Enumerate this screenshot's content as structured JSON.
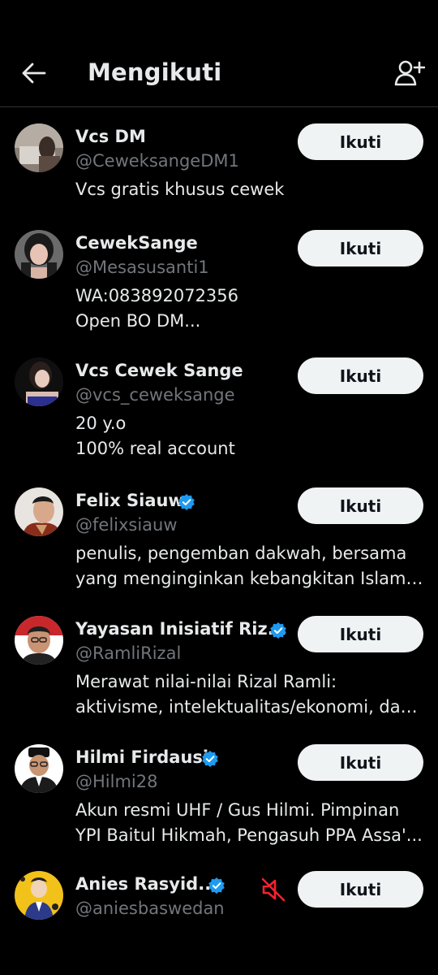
{
  "header": {
    "title": "Mengikuti"
  },
  "colors": {
    "background": "#000000",
    "text": "#e7e9ea",
    "secondary": "#71767b",
    "verified": "#1d9bf0",
    "button_bg": "#eff3f4",
    "muted": "#f4212e"
  },
  "users": [
    {
      "name": "Vcs DM",
      "handle": "@CeweksangeDM1",
      "bio": [
        "Vcs gratis khusus cewek"
      ],
      "verified": false,
      "follow_label": "Ikuti"
    },
    {
      "name": "CewekSange",
      "handle": "@Mesasusanti1",
      "bio": [
        "WA:083892072356",
        "Open BO DM..."
      ],
      "verified": false,
      "follow_label": "Ikuti"
    },
    {
      "name": "Vcs Cewek Sange",
      "handle": "@vcs_ceweksange",
      "bio": [
        "20 y.o",
        "100% real account"
      ],
      "verified": false,
      "follow_label": "Ikuti"
    },
    {
      "name": "Felix Siauw",
      "handle": "@felixsiauw",
      "bio": [
        "penulis, pengemban dakwah, bersama",
        "yang menginginkan kebangkitan Islam, ..."
      ],
      "verified": true,
      "follow_label": "Ikuti"
    },
    {
      "name": "Yayasan Inisiatif Riz...",
      "handle": "@RamliRizal",
      "bio": [
        "Merawat nilai-nilai Rizal Ramli:",
        "aktivisme, intelektualitas/ekonomi, dan..."
      ],
      "verified": true,
      "follow_label": "Ikuti"
    },
    {
      "name": "Hilmi Firdausi",
      "handle": "@Hilmi28",
      "bio": [
        "Akun resmi UHF / Gus Hilmi. Pimpinan",
        "YPI Baitul Hikmah, Pengasuh PPA Assa'..."
      ],
      "verified": true,
      "follow_label": "Ikuti"
    },
    {
      "name": "Anies Rasyid...",
      "handle": "@aniesbaswedan",
      "bio": [],
      "verified": true,
      "muted": true,
      "follow_label": "Ikuti"
    }
  ]
}
